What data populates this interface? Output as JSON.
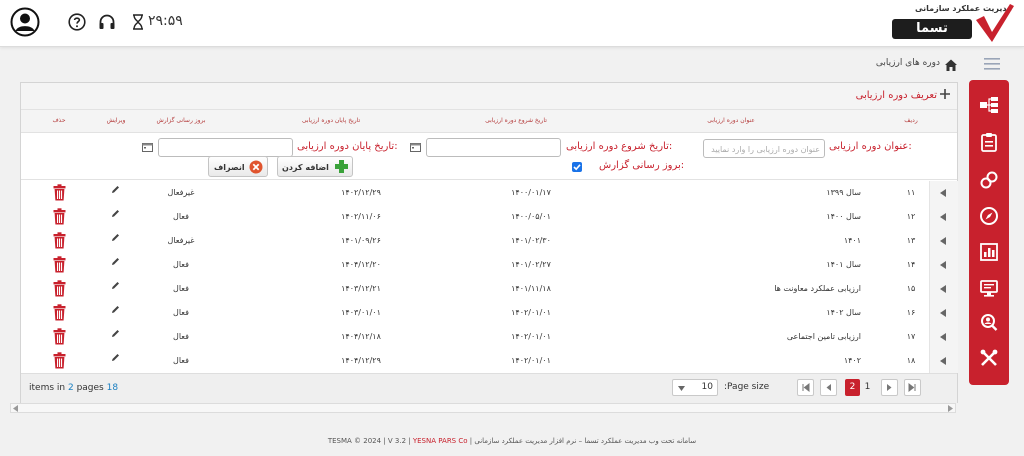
{
  "header": {
    "timer": "۲۹:۵۹",
    "logo_subtitle": "مدیریت عملکرد سازمانی",
    "logo_text": "تسما"
  },
  "breadcrumb": {
    "label": "دوره های ارزیابی"
  },
  "panel": {
    "title": "تعریف دوره ارزیابی"
  },
  "columns": {
    "row_no": "ردیف",
    "title": "عنوان دوره ارزیابی",
    "start": "تاریخ شروع دوره ارزیابی",
    "end": "تاریخ پایان دوره ارزیابی",
    "update": "بروز رسانی گزارش",
    "edit": "ویرایش",
    "delete": "حذف"
  },
  "form": {
    "title_label": "عنوان دوره ارزیابی:",
    "title_placeholder": "عنوان دوره ارزیابی را وارد نمایید",
    "start_label": "تاریخ شروع دوره ارزیابی:",
    "end_label": "تاریخ پایان دوره ارزیابی:",
    "update_label": "بروز رسانی گزارش:",
    "add_button": "اضافه کردن",
    "cancel_button": "انصراف"
  },
  "rows": [
    {
      "no": "۱۱",
      "title": "سال ۱۳۹۹",
      "start": "۱۴۰۰/۰۱/۱۷",
      "end": "۱۴۰۲/۱۲/۲۹",
      "status": "غیرفعال"
    },
    {
      "no": "۱۲",
      "title": "سال ۱۴۰۰",
      "start": "۱۴۰۰/۰۵/۰۱",
      "end": "۱۴۰۲/۱۱/۰۶",
      "status": "فعال"
    },
    {
      "no": "۱۳",
      "title": "۱۴۰۱",
      "start": "۱۴۰۱/۰۲/۳۰",
      "end": "۱۴۰۱/۰۹/۲۶",
      "status": "غیرفعال"
    },
    {
      "no": "۱۴",
      "title": "سال ۱۴۰۱",
      "start": "۱۴۰۱/۰۲/۲۷",
      "end": "۱۴۰۴/۱۲/۲۰",
      "status": "فعال"
    },
    {
      "no": "۱۵",
      "title": "ارزیابی عملکرد معاونت ها",
      "start": "۱۴۰۱/۱۱/۱۸",
      "end": "۱۴۰۳/۱۲/۲۱",
      "status": "فعال"
    },
    {
      "no": "۱۶",
      "title": "سال ۱۴۰۲",
      "start": "۱۴۰۲/۰۱/۰۱",
      "end": "۱۴۰۳/۰۱/۰۱",
      "status": "فعال"
    },
    {
      "no": "۱۷",
      "title": "ارزیابی تامین اجتماعی",
      "start": "۱۴۰۲/۰۱/۰۱",
      "end": "۱۴۰۴/۱۲/۱۸",
      "status": "فعال"
    },
    {
      "no": "۱۸",
      "title": "۱۴۰۲",
      "start": "۱۴۰۲/۰۱/۰۱",
      "end": "۱۴۰۴/۱۲/۲۹",
      "status": "فعال"
    }
  ],
  "pager": {
    "items_prefix": "items in",
    "pages_count": "2",
    "pages_word": "pages",
    "total": "18",
    "page_size_label": ":Page size",
    "page_size_value": "10",
    "current_page": "2",
    "other_page": "1"
  },
  "footer": {
    "prefix": "TESMA © 2024 | V 3.2 |",
    "brand": "YESNA PARS Co",
    "suffix": "| سامانه تحت وب مدیریت عملکرد تسما – نرم افزار مدیریت عملکرد سازمانی"
  },
  "colors": {
    "accent": "#c8212d",
    "link": "#1a7fc1"
  }
}
